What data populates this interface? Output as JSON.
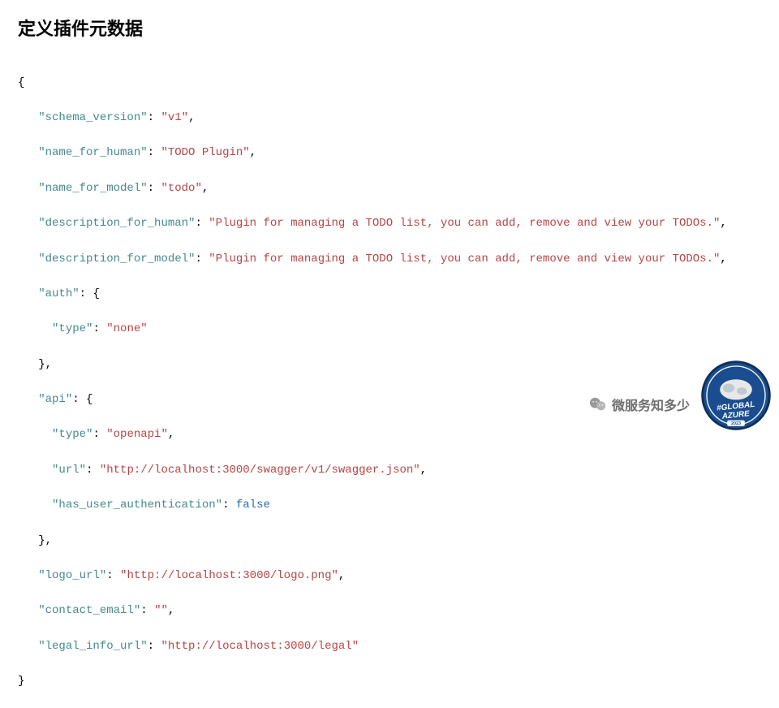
{
  "title": "定义插件元数据",
  "code": {
    "open_brace": "{",
    "schema_version_key": "\"schema_version\"",
    "schema_version_val": "\"v1\"",
    "name_for_human_key": "\"name_for_human\"",
    "name_for_human_val": "\"TODO Plugin\"",
    "name_for_model_key": "\"name_for_model\"",
    "name_for_model_val": "\"todo\"",
    "description_for_human_key": "\"description_for_human\"",
    "description_for_human_val": "\"Plugin for managing a TODO list, you can add, remove and view your TODOs.\"",
    "description_for_model_key": "\"description_for_model\"",
    "description_for_model_val": "\"Plugin for managing a TODO list, you can add, remove and view your TODOs.\"",
    "auth_key": "\"auth\"",
    "auth_type_key": "\"type\"",
    "auth_type_val": "\"none\"",
    "api_key": "\"api\"",
    "api_type_key": "\"type\"",
    "api_type_val": "\"openapi\"",
    "api_url_key": "\"url\"",
    "api_url_val": "\"http://localhost:3000/swagger/v1/swagger.json\"",
    "has_user_auth_key": "\"has_user_authentication\"",
    "has_user_auth_val": "false",
    "logo_url_key": "\"logo_url\"",
    "logo_url_val": "\"http://localhost:3000/logo.png\"",
    "contact_email_key": "\"contact_email\"",
    "contact_email_val": "\"\"",
    "legal_info_url_key": "\"legal_info_url\"",
    "legal_info_url_val": "\"http://localhost:3000/legal\"",
    "close_brace": "}",
    "close_brace_comma": "},",
    "colon_space": ": ",
    "comma": ",",
    "open_obj": ": {"
  },
  "watermark": {
    "text": "微服务知多少"
  },
  "badge": {
    "label_top": "GLOBAL",
    "label_bottom": "AZURE",
    "year": "2023"
  }
}
